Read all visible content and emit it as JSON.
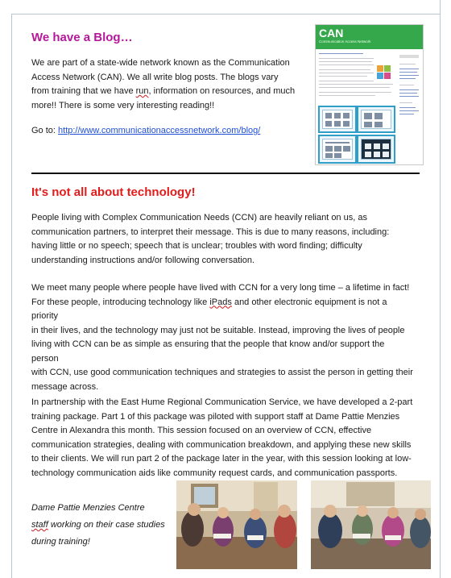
{
  "blog": {
    "title": "We have a Blog…",
    "intro_lines": [
      "We are part of a state-wide network known as the Communication",
      "Access Network (CAN).  We all write blog posts.  The blogs vary",
      "from training that we have run, information on resources, and much",
      "more!!  There is some very interesting reading!!"
    ],
    "goto_label": "Go to: ",
    "link_text": "http://www.communicationaccessnetwork.com/blog/",
    "thumbnail_logo": "CAN",
    "thumbnail_logo_sub": "Communication Access Network"
  },
  "technology": {
    "title": "It's not all about technology!",
    "para1_lines": [
      "People living with Complex Communication Needs (CCN) are heavily reliant on us, as",
      "communication partners, to interpret their message.  This is due to many reasons, including:",
      "having little or no speech; speech that is unclear; troubles with word finding; difficulty",
      "understanding instructions and/or following conversation."
    ],
    "para2_lines": [
      "We meet many people where people have lived with CCN for a very long time – a lifetime in fact!",
      "For these people, introducing technology like iPads and other electronic equipment is not a priority",
      "in their lives, and the technology may just not be suitable.  Instead, improving the lives of people",
      "living with CCN can be as simple as ensuring that the people that know and/or support the person",
      "with CCN, use good communication techniques and strategies to assist the person in getting their",
      "message across."
    ],
    "para3_lines": [
      "In partnership with the East Hume Regional Communication Service, we have developed a 2-part",
      "training package.  Part 1 of this package was piloted with support staff at Dame Pattie Menzies",
      "Centre in Alexandra this month.  This session focused on an overview of CCN, effective",
      "communication strategies, dealing with communication breakdown, and applying these new skills",
      "to their clients.  We will run part 2 of the package later in the year, with this session looking at low-",
      "technology communication aids like community request cards, and communication passports."
    ],
    "caption_lines": [
      "Dame Pattie  Menzies Centre",
      "staff working on their case studies",
      "during training!"
    ]
  },
  "colors": {
    "blog_title": "#b5199a",
    "tech_title": "#e21b1b",
    "link": "#1f4fd6",
    "can_green": "#34a84a"
  }
}
